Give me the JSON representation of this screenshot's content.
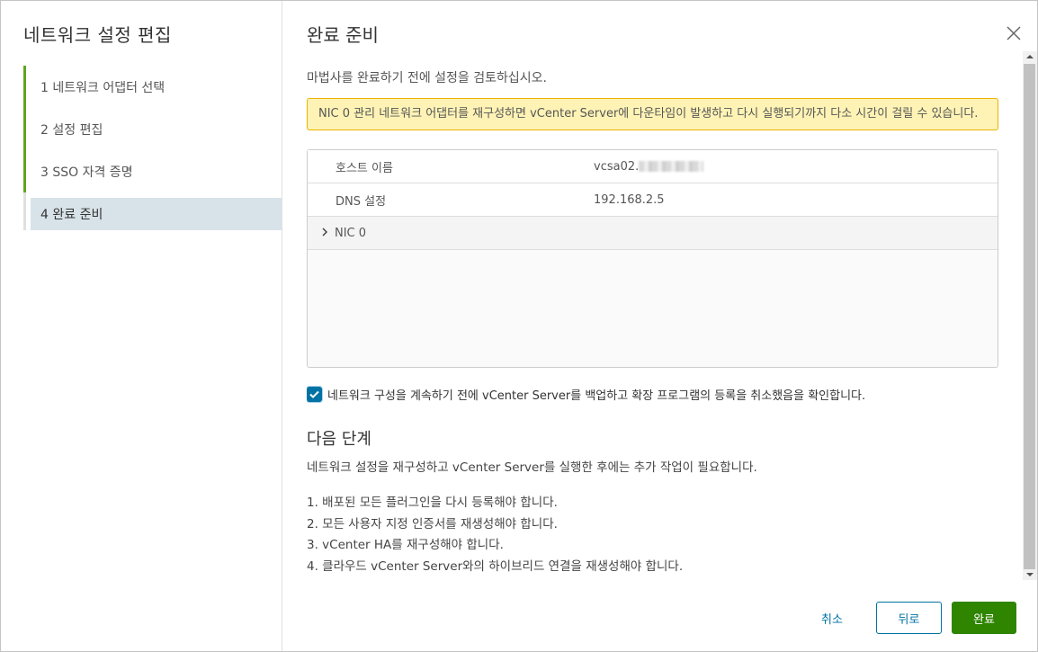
{
  "wizard": {
    "title": "네트워크 설정 편집",
    "steps": [
      {
        "label": "1 네트워크 어댑터 선택"
      },
      {
        "label": "2 설정 편집"
      },
      {
        "label": "3 SSO 자격 증명"
      },
      {
        "label": "4 완료 준비"
      }
    ]
  },
  "page": {
    "title": "완료 준비",
    "intro": "마법사를 완료하기 전에 설정을 검토하십시오.",
    "warning": "NIC 0 관리 네트워크 어댑터를 재구성하면 vCenter Server에 다운타임이 발생하고 다시 실행되기까지 다소 시간이 걸릴 수 있습니다."
  },
  "summary": {
    "host_label": "호스트 이름",
    "host_value": "vcsa02.",
    "dns_label": "DNS 설정",
    "dns_value": "192.168.2.5",
    "nic_label": "NIC 0"
  },
  "confirm": {
    "checked": true,
    "label": "네트워크 구성을 계속하기 전에 vCenter Server를 백업하고 확장 프로그램의 등록을 취소했음을 확인합니다."
  },
  "next_steps": {
    "title": "다음 단계",
    "description": "네트워크 설정을 재구성하고 vCenter Server를 실행한 후에는 추가 작업이 필요합니다.",
    "items": [
      "1. 배포된 모든 플러그인을 다시 등록해야 합니다.",
      "2. 모든 사용자 지정 인증서를 재생성해야 합니다.",
      "3. vCenter HA를 재구성해야 합니다.",
      "4. 클라우드 vCenter Server와의 하이브리드 연결을 재생성해야 합니다."
    ]
  },
  "footer": {
    "cancel": "취소",
    "back": "뒤로",
    "finish": "완료"
  },
  "colors": {
    "accent": "#0072a3",
    "done": "#62a420",
    "finish": "#2f8400",
    "warning_bg": "#fef3b5"
  }
}
